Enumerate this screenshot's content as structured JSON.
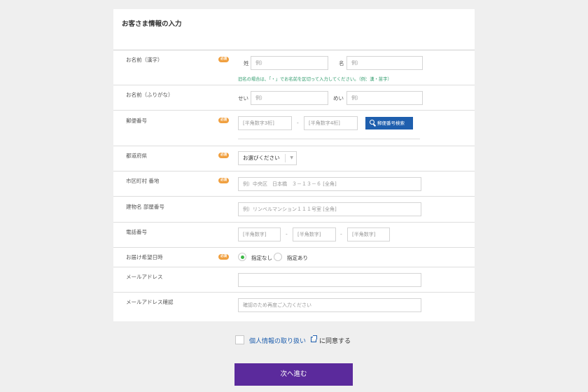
{
  "form": {
    "title": "お客さま情報の入力",
    "required_badge": "必須",
    "name_kanji": {
      "label": "お名前（漢字）",
      "last_label": "姓",
      "last_placeholder": "例）",
      "first_label": "名",
      "first_placeholder": "例）",
      "note": "旧名の場合は、「・」でお名前を区切って入力してください。（例：漢・苗字）"
    },
    "name_kana": {
      "label": "お名前（ふりがな）",
      "last_label": "せい",
      "last_placeholder": "例）",
      "first_label": "めい",
      "first_placeholder": "例）"
    },
    "postal": {
      "label": "郵便番号",
      "first_placeholder": "[半角数字3桁]",
      "dash": "-",
      "second_placeholder": "[半角数字4桁]",
      "search_button": "郵便番号検索"
    },
    "prefecture": {
      "label": "都道府県",
      "selected": "お選びください"
    },
    "city": {
      "label": "市区町村 番地",
      "placeholder": "例）中央区　日本橋　３－１３－６ [全角]"
    },
    "building": {
      "label": "建物名 部屋番号",
      "placeholder": "例）リンベルマンション１１１号室 [全角]"
    },
    "phone": {
      "label": "電話番号",
      "p1": "[半角数字]",
      "p2": "[半角数字]",
      "p3": "[半角数字]",
      "dash": "-"
    },
    "delivery": {
      "label": "お届け希望日時",
      "option_none": "指定なし",
      "option_some": "指定あり"
    },
    "email": {
      "label": "メールアドレス",
      "placeholder": ""
    },
    "email_confirm": {
      "label": "メールアドレス確認",
      "placeholder": "確認のため再度ご入力ください"
    }
  },
  "agreement": {
    "link": "個人情報の取り扱い",
    "tail": "に同意する"
  },
  "next_button": "次へ進む",
  "colors": {
    "accent_purple": "#5b2a9c",
    "link_blue": "#1f5fae",
    "badge_orange": "#f0a040",
    "radio_green": "#3db847"
  }
}
